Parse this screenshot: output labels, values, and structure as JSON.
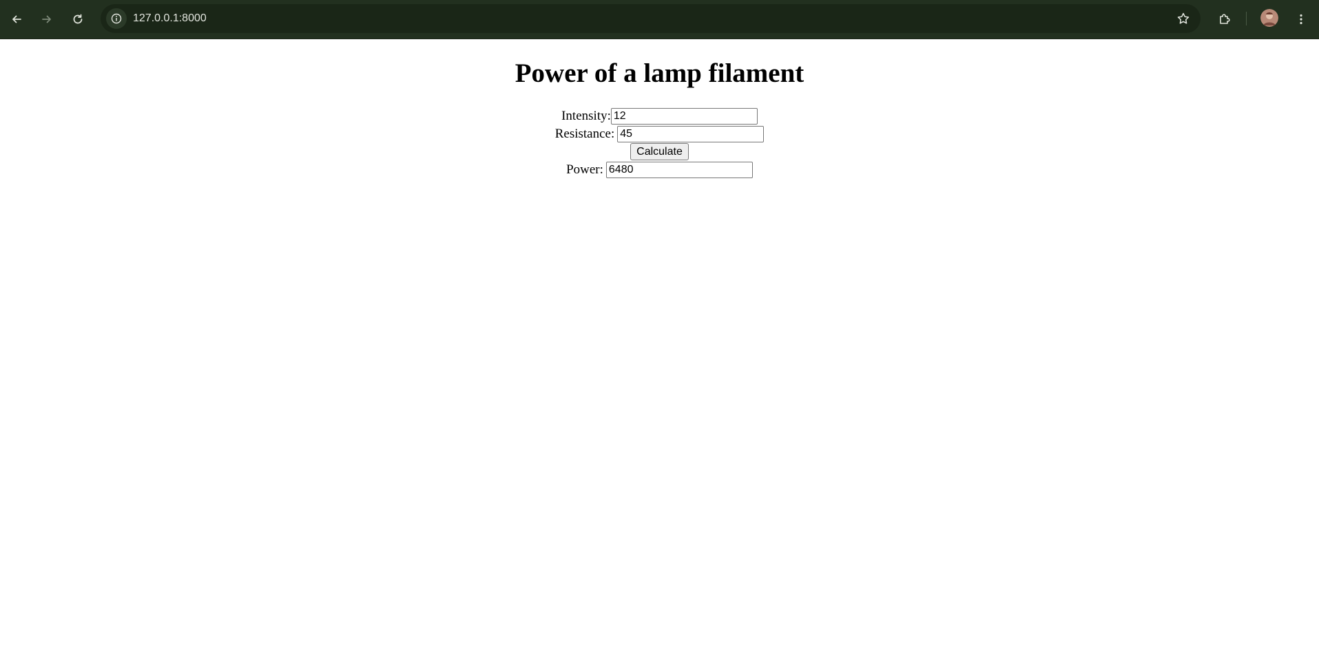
{
  "browser": {
    "url": "127.0.0.1:8000",
    "icons": {
      "back": "arrow-left-icon",
      "forward": "arrow-right-icon",
      "reload": "reload-icon",
      "site_info": "info-icon",
      "bookmark": "star-icon",
      "extensions": "puzzle-icon",
      "menu": "three-dots-icon"
    },
    "colors": {
      "toolbar": "#22301f",
      "omnibox": "#1a2617"
    }
  },
  "page": {
    "title": "Power of a lamp filament",
    "form": {
      "intensity_label": "Intensity:",
      "intensity_value": "12",
      "resistance_label": "Resistance:",
      "resistance_value": "45",
      "calculate_label": "Calculate",
      "power_label": "Power:",
      "power_value": "6480"
    }
  }
}
